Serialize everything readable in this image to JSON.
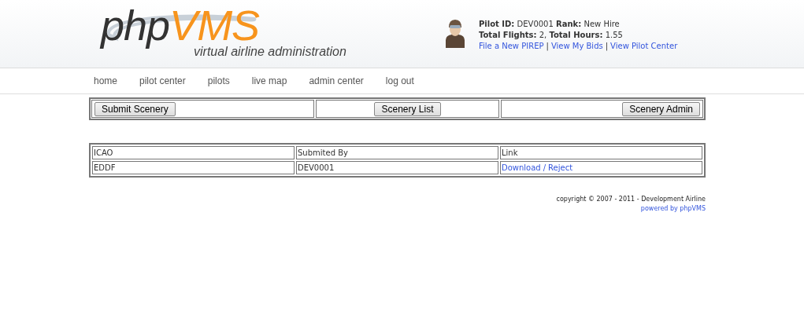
{
  "logo": {
    "name_part1": "php",
    "name_part2": "VMS",
    "tagline": "virtual airline administration"
  },
  "pilot": {
    "lines": [
      "**Pilot ID:** DEV0001 **Rank:** New Hire",
      "**Total Flights:** 2, **Total Hours:** 1.55"
    ],
    "links": [
      "File a New PIREP",
      "View My Bids",
      "View Pilot Center"
    ],
    "separator": "|"
  },
  "nav": [
    "home",
    "pilot center",
    "pilots",
    "live map",
    "admin center",
    "log out"
  ],
  "toolbar": [
    {
      "label": "Submit Scenery"
    },
    {
      "label": "Scenery List"
    },
    {
      "label": "Scenery Admin"
    }
  ],
  "table": {
    "columns": [
      "ICAO",
      "Submited By",
      "Link"
    ],
    "rows": [
      {
        "icao": "EDDF",
        "submitted_by": "DEV0001",
        "links": [
          "Download",
          "Reject"
        ],
        "separator": "/"
      }
    ]
  },
  "footer": {
    "copyright": "copyright © 2007 - 2011 - Development Airline",
    "powered": "powered by phpVMS"
  }
}
